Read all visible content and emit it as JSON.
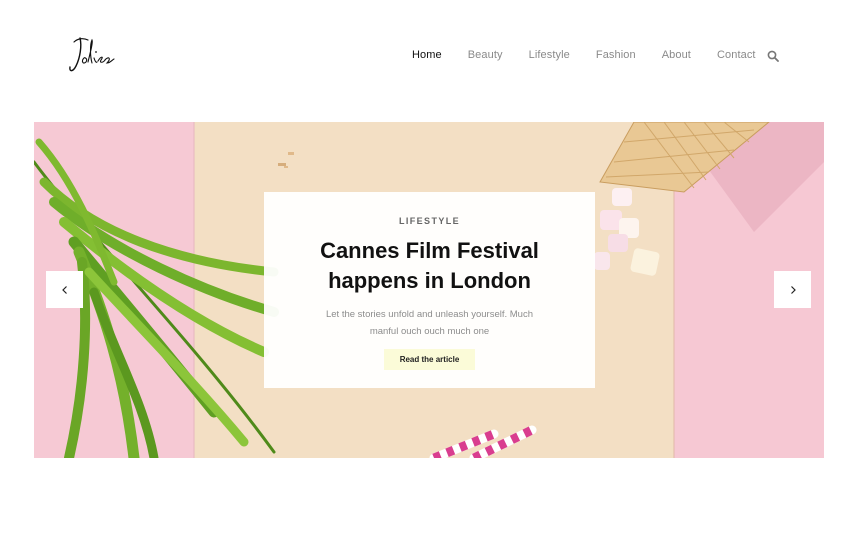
{
  "brand": {
    "logo_icon": "jolies-script-logo",
    "logo_text": "Jolies"
  },
  "nav": {
    "items": [
      {
        "label": "Home",
        "active": true
      },
      {
        "label": "Beauty",
        "active": false
      },
      {
        "label": "Lifestyle",
        "active": false
      },
      {
        "label": "Fashion",
        "active": false
      },
      {
        "label": "About",
        "active": false
      },
      {
        "label": "Contact",
        "active": false
      }
    ],
    "search_icon": "search-icon"
  },
  "hero": {
    "category": "LIFESTYLE",
    "title": "Cannes Film Festival happens in London",
    "excerpt": "Let the stories unfold and unleash yourself. Much manful ouch ouch much one",
    "cta_label": "Read the article",
    "prev_icon": "chevron-left-icon",
    "next_icon": "chevron-right-icon",
    "colors": {
      "pink": "#f6c9d4",
      "beige": "#f3dfc4",
      "leaf": "#6fae2a",
      "button_bg": "#fbfbd8"
    }
  }
}
